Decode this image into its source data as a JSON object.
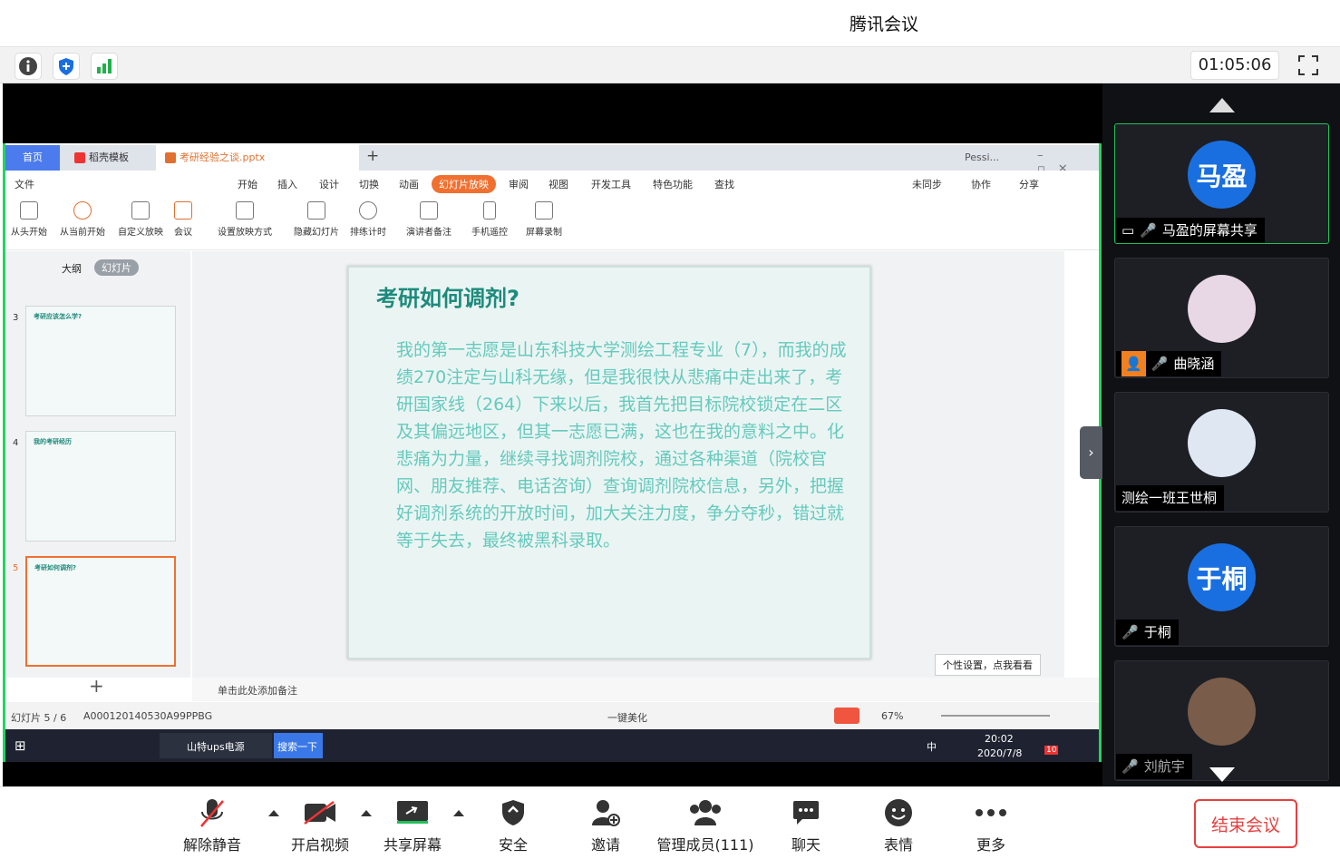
{
  "window": {
    "title": "腾讯会议"
  },
  "topbar": {
    "timer": "01:05:06"
  },
  "wps": {
    "tabs": {
      "home": "首页",
      "template": "稻壳模板",
      "doc": "考研经验之谈.pptx",
      "account": "Pessi..."
    },
    "menu": {
      "file": "文件",
      "start": "开始",
      "insert": "插入",
      "design": "设计",
      "switch": "切换",
      "anim": "动画",
      "slideshow": "幻灯片放映",
      "review": "审阅",
      "view": "视图",
      "devtools": "开发工具",
      "special": "特色功能",
      "search": "查找",
      "unsync": "未同步",
      "coop": "协作",
      "share": "分享"
    },
    "ribbon": [
      "从头开始",
      "从当前开始",
      "自定义放映",
      "会议",
      "设置放映方式",
      "隐藏幻灯片",
      "排练计时",
      "演讲者备注",
      "手机遥控",
      "屏幕录制"
    ],
    "pane_tabs": {
      "outline": "大纲",
      "slides": "幻灯片"
    },
    "thumbs": [
      {
        "num": "3",
        "title": "考研应该怎么学?"
      },
      {
        "num": "4",
        "title": "我的考研经历"
      },
      {
        "num": "5",
        "title": "考研如何调剂?"
      }
    ],
    "slide": {
      "title": "考研如何调剂?",
      "body": "我的第一志愿是山东科技大学测绘工程专业（7），而我的成绩270注定与山科无缘，但是我很快从悲痛中走出来了，考研国家线（264）下来以后，我首先把目标院校锁定在二区及其偏远地区，但其一志愿已满，这也在我的意料之中。化悲痛为力量，继续寻找调剂院校，通过各种渠道（院校官网、朋友推荐、电话咨询）查询调剂院校信息，另外，把握好调剂系统的开放时间，加大关注力度，争分夺秒，错过就等于失去，最终被黑科录取。"
    },
    "tooltip": "个性设置，点我看看",
    "note": "单击此处添加备注",
    "status": {
      "slide": "幻灯片 5 / 6",
      "id": "A000120140530A99PPBG",
      "beautify": "一键美化",
      "zoom": "67%"
    },
    "taskbar": {
      "app1": "山特ups电源",
      "search": "搜索一下",
      "ime": "中",
      "time": "20:02",
      "date": "2020/7/8",
      "badge": "10"
    }
  },
  "participants": [
    {
      "name": "马盈的屏幕共享",
      "initials": "马盈",
      "color": "#1a6fe0"
    },
    {
      "name": "曲晓涵"
    },
    {
      "name": "测绘一班王世桐"
    },
    {
      "name": "于桐",
      "initials": "于桐",
      "color": "#1a6fe0"
    },
    {
      "name": "刘航宇"
    }
  ],
  "toolbar": {
    "mute": "解除静音",
    "video": "开启视频",
    "share": "共享屏幕",
    "security": "安全",
    "invite": "邀请",
    "members": "管理成员(111)",
    "chat": "聊天",
    "emoji": "表情",
    "more": "更多",
    "end": "结束会议"
  }
}
